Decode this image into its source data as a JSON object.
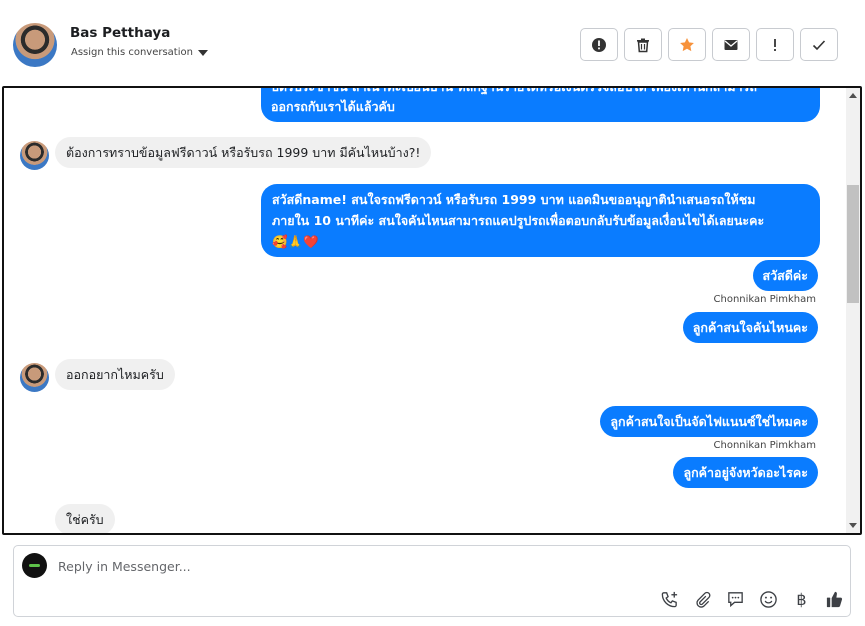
{
  "header": {
    "contact_name": "Bas Petthaya",
    "assign_label": "Assign this conversation",
    "actions": [
      {
        "name": "spam",
        "icon": "alert-circle-icon"
      },
      {
        "name": "delete",
        "icon": "trash-icon"
      },
      {
        "name": "star",
        "icon": "star-icon"
      },
      {
        "name": "mark-unread",
        "icon": "envelope-icon"
      },
      {
        "name": "follow-up",
        "icon": "exclamation-icon"
      },
      {
        "name": "done",
        "icon": "check-icon"
      }
    ],
    "star_color": "#f7923b"
  },
  "messages": {
    "m0": "บัตรประชาชน สำเนาทะเบียนบ้าน หลักฐานรายได้หรือเงินตรวจสอบได้ เพียงเท่านี้ก็สามารถ\nออกรถกับเราได้แล้วคับ",
    "m1": "ต้องการทราบข้อมูลฟรีดาวน์ หรือรับรถ 1999 บาท มีคันไหนบ้าง?!",
    "m2_line1": "สวัสดีname! สนใจรถฟรีดาวน์ หรือรับรถ 1999 บาท แอดมินขออนุญาตินำเสนอรถให้ชม",
    "m2_line2": "ภายใน 10 นาทีค่ะ สนใจคันไหนสามารถแคปรูปรถเพื่อตอบกลับรับข้อมูลเงื่อนไขได้เลยนะคะ",
    "m2_emoji": "🥰🙏❤️",
    "m3": "สวัสดีค่ะ",
    "m3_sender": "Chonnikan Pimkham",
    "m4": "ลูกค้าสนใจคันไหนคะ",
    "m5": "ออกอยากไหมครับ",
    "m6": "ลูกค้าสนใจเป็นจัดไฟแนนซ์ใช่ไหมคะ",
    "m6_sender": "Chonnikan Pimkham",
    "m7": "ลูกค้าอยู่จังหวัดอะไรคะ",
    "m8": "ใช่ครับ"
  },
  "reply": {
    "placeholder": "Reply in Messenger...",
    "tools": [
      "phone-plus-icon",
      "paperclip-icon",
      "saved-reply-icon",
      "emoji-icon",
      "baht-icon",
      "thumbs-up-icon"
    ],
    "baht_symbol": "฿"
  },
  "colors": {
    "outgoing": "#0a7cff",
    "incoming": "#f0f0f0"
  }
}
